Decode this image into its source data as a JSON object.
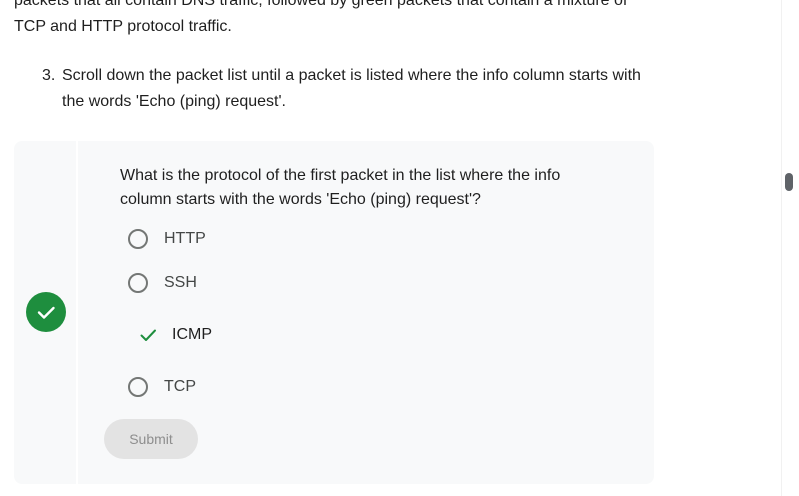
{
  "intro": {
    "text_line1": "packets that all contain DNS traffic, followed by green packets that contain a mixture of",
    "text_line2": "TCP and HTTP protocol traffic."
  },
  "step": {
    "number": "3.",
    "text": "Scroll down the packet list until a packet is listed where the info column starts with the words 'Echo (ping) request'."
  },
  "quiz": {
    "question": "What is the protocol of the first packet in the list where the info column starts with the words 'Echo (ping) request'?",
    "options": [
      {
        "label": "HTTP",
        "state": "unselected"
      },
      {
        "label": "SSH",
        "state": "unselected"
      },
      {
        "label": "ICMP",
        "state": "correct"
      },
      {
        "label": "TCP",
        "state": "unselected"
      }
    ],
    "submit_label": "Submit",
    "status_icon": "check-circle-icon",
    "status": "correct"
  },
  "colors": {
    "success": "#1e8e3e",
    "card_bg": "#f8f9fa",
    "disabled_button_bg": "#e3e3e3",
    "disabled_button_text": "#8e8e8e"
  }
}
